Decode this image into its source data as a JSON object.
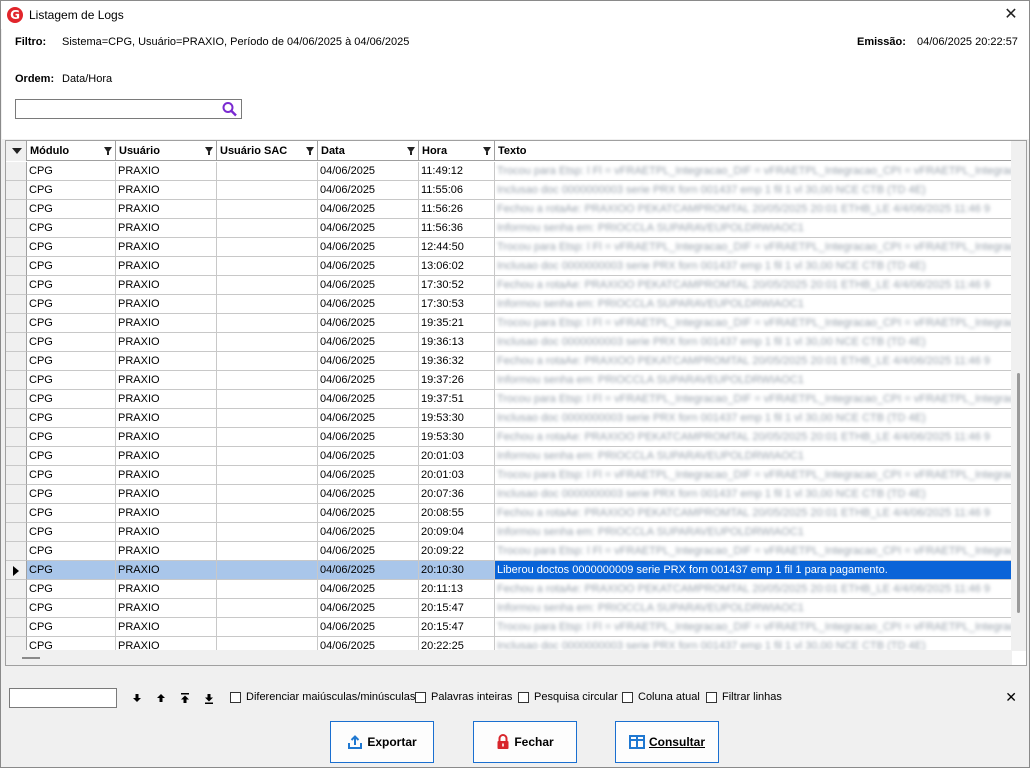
{
  "window": {
    "title": "Listagem de Logs"
  },
  "info": {
    "filter_label": "Filtro:",
    "filter_value": "Sistema=CPG, Usuário=PRAXIO, Período de 04/06/2025 à 04/06/2025",
    "emission_label": "Emissão:",
    "emission_value": "04/06/2025 20:22:57",
    "order_label": "Ordem:",
    "order_value": "Data/Hora",
    "search_value": ""
  },
  "grid": {
    "columns": [
      "Módulo",
      "Usuário",
      "Usuário SAC",
      "Data",
      "Hora",
      "Texto"
    ],
    "selected_text": "Liberou doctos 0000000009 serie PRX forn 001437 emp 1 fil 1 para pagamento.",
    "rows": [
      {
        "modulo": "CPG",
        "usuario": "PRAXIO",
        "sac": "",
        "data": "04/06/2025",
        "hora": "11:49:12"
      },
      {
        "modulo": "CPG",
        "usuario": "PRAXIO",
        "sac": "",
        "data": "04/06/2025",
        "hora": "11:55:06"
      },
      {
        "modulo": "CPG",
        "usuario": "PRAXIO",
        "sac": "",
        "data": "04/06/2025",
        "hora": "11:56:26"
      },
      {
        "modulo": "CPG",
        "usuario": "PRAXIO",
        "sac": "",
        "data": "04/06/2025",
        "hora": "11:56:36"
      },
      {
        "modulo": "CPG",
        "usuario": "PRAXIO",
        "sac": "",
        "data": "04/06/2025",
        "hora": "12:44:50"
      },
      {
        "modulo": "CPG",
        "usuario": "PRAXIO",
        "sac": "",
        "data": "04/06/2025",
        "hora": "13:06:02"
      },
      {
        "modulo": "CPG",
        "usuario": "PRAXIO",
        "sac": "",
        "data": "04/06/2025",
        "hora": "17:30:52"
      },
      {
        "modulo": "CPG",
        "usuario": "PRAXIO",
        "sac": "",
        "data": "04/06/2025",
        "hora": "17:30:53"
      },
      {
        "modulo": "CPG",
        "usuario": "PRAXIO",
        "sac": "",
        "data": "04/06/2025",
        "hora": "19:35:21"
      },
      {
        "modulo": "CPG",
        "usuario": "PRAXIO",
        "sac": "",
        "data": "04/06/2025",
        "hora": "19:36:13"
      },
      {
        "modulo": "CPG",
        "usuario": "PRAXIO",
        "sac": "",
        "data": "04/06/2025",
        "hora": "19:36:32"
      },
      {
        "modulo": "CPG",
        "usuario": "PRAXIO",
        "sac": "",
        "data": "04/06/2025",
        "hora": "19:37:26"
      },
      {
        "modulo": "CPG",
        "usuario": "PRAXIO",
        "sac": "",
        "data": "04/06/2025",
        "hora": "19:37:51"
      },
      {
        "modulo": "CPG",
        "usuario": "PRAXIO",
        "sac": "",
        "data": "04/06/2025",
        "hora": "19:53:30"
      },
      {
        "modulo": "CPG",
        "usuario": "PRAXIO",
        "sac": "",
        "data": "04/06/2025",
        "hora": "19:53:30"
      },
      {
        "modulo": "CPG",
        "usuario": "PRAXIO",
        "sac": "",
        "data": "04/06/2025",
        "hora": "20:01:03"
      },
      {
        "modulo": "CPG",
        "usuario": "PRAXIO",
        "sac": "",
        "data": "04/06/2025",
        "hora": "20:01:03"
      },
      {
        "modulo": "CPG",
        "usuario": "PRAXIO",
        "sac": "",
        "data": "04/06/2025",
        "hora": "20:07:36"
      },
      {
        "modulo": "CPG",
        "usuario": "PRAXIO",
        "sac": "",
        "data": "04/06/2025",
        "hora": "20:08:55"
      },
      {
        "modulo": "CPG",
        "usuario": "PRAXIO",
        "sac": "",
        "data": "04/06/2025",
        "hora": "20:09:04"
      },
      {
        "modulo": "CPG",
        "usuario": "PRAXIO",
        "sac": "",
        "data": "04/06/2025",
        "hora": "20:09:22"
      },
      {
        "modulo": "CPG",
        "usuario": "PRAXIO",
        "sac": "",
        "data": "04/06/2025",
        "hora": "20:10:30",
        "selected": true
      },
      {
        "modulo": "CPG",
        "usuario": "PRAXIO",
        "sac": "",
        "data": "04/06/2025",
        "hora": "20:11:13"
      },
      {
        "modulo": "CPG",
        "usuario": "PRAXIO",
        "sac": "",
        "data": "04/06/2025",
        "hora": "20:15:47"
      },
      {
        "modulo": "CPG",
        "usuario": "PRAXIO",
        "sac": "",
        "data": "04/06/2025",
        "hora": "20:15:47"
      },
      {
        "modulo": "CPG",
        "usuario": "PRAXIO",
        "sac": "",
        "data": "04/06/2025",
        "hora": "20:22:25"
      }
    ]
  },
  "findbar": {
    "value": "",
    "options": [
      "Diferenciar maiúsculas/minúsculas",
      "Palavras inteiras",
      "Pesquisa circular",
      "Coluna atual",
      "Filtrar linhas"
    ]
  },
  "buttons": {
    "export": "Exportar",
    "close": "Fechar",
    "query": "Consultar"
  },
  "colors": {
    "selection": "#0a64d8",
    "selection_row": "#a9c6ea",
    "button_border": "#1a6fd0",
    "icon_blue": "#1f78d1",
    "icon_red": "#d8262c"
  }
}
